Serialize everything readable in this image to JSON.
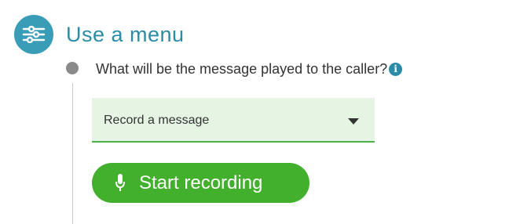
{
  "section": {
    "title": "Use a menu",
    "icon": "sliders-icon",
    "icon_color": "#3a9db8"
  },
  "step": {
    "question": "What will be the message played to the caller?",
    "info_icon": "info-icon"
  },
  "message_select": {
    "selected": "Record a message",
    "background": "#e6f5e3",
    "accent": "#4cb04a"
  },
  "record_button": {
    "label": "Start recording",
    "icon": "microphone-icon",
    "color": "#42b02d"
  }
}
